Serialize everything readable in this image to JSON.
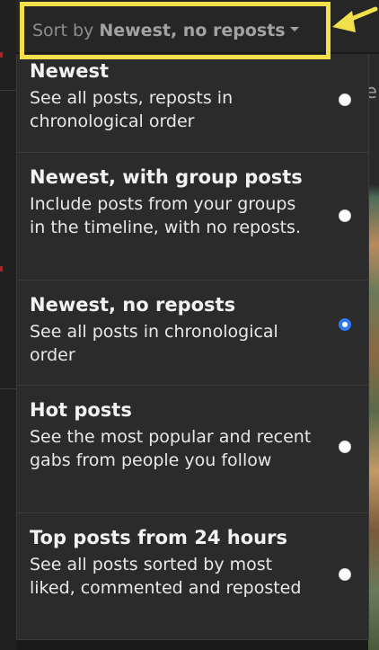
{
  "sort": {
    "prefix": "Sort by",
    "value": "Newest, no reposts"
  },
  "menu": {
    "items": [
      {
        "title": "Newest",
        "description": "See all posts, reposts in chronological order",
        "checked": false
      },
      {
        "title": "Newest, with group posts",
        "description": "Include posts from your groups in the timeline, with no reposts.",
        "checked": false
      },
      {
        "title": "Newest, no reposts",
        "description": "See all posts in chronological order",
        "checked": true
      },
      {
        "title": "Hot posts",
        "description": "See the most popular and recent gabs from people you follow",
        "checked": false
      },
      {
        "title": "Top posts from 24 hours",
        "description": "See all posts sorted by most liked, commented and reposted",
        "checked": false
      }
    ]
  },
  "colors": {
    "highlight": "#f2e04a",
    "radio_selected": "#2f78f3",
    "menu_background": "#2b2b2b"
  }
}
